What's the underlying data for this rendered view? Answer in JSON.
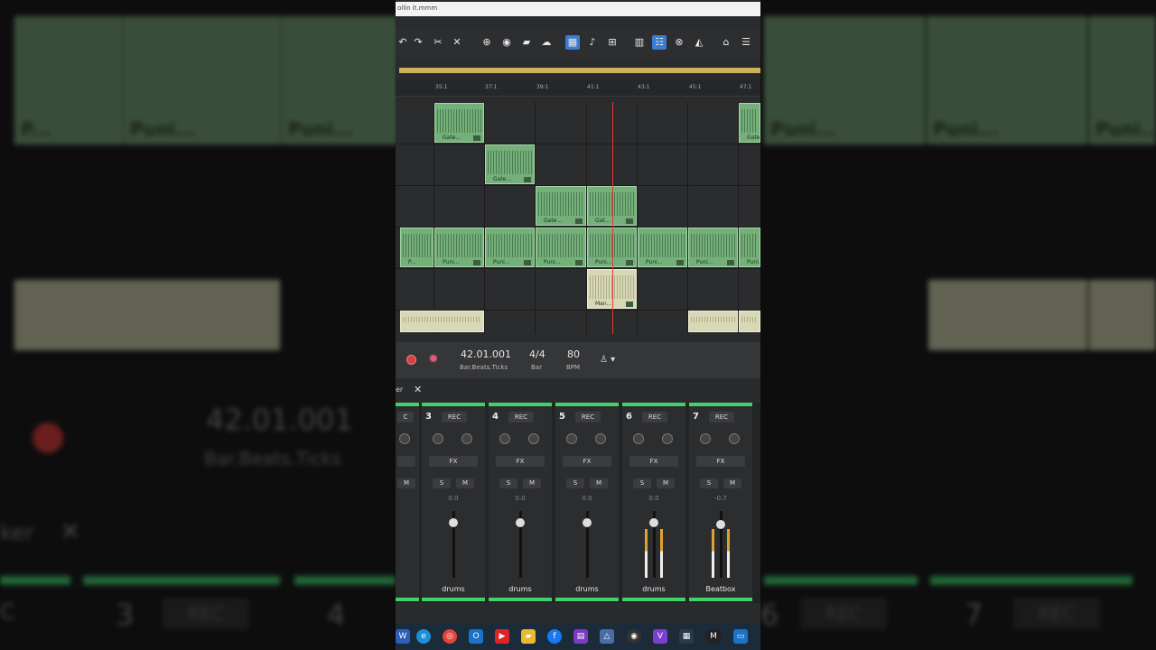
{
  "window": {
    "title": "ollin it.mmm"
  },
  "ruler": {
    "markers": [
      "35:1",
      "37:1",
      "39:1",
      "41:1",
      "43:1",
      "45:1",
      "47:1"
    ]
  },
  "clips": {
    "gate": "Gate...",
    "gat": "Gat...",
    "puni": "Puni...",
    "p": "P...",
    "man": "Man..."
  },
  "transport": {
    "position": "42.01.001",
    "position_label": "Bar.Beats.Ticks",
    "signature": "4/4",
    "signature_label": "Bar",
    "tempo": "80",
    "tempo_label": "BPM",
    "record_color": "#d84040"
  },
  "mixer": {
    "tab_label": "er",
    "partial_strip": {
      "rec": "C",
      "mute": "M",
      "name": "s"
    },
    "strips": [
      {
        "number": "3",
        "rec": "REC",
        "fx": "FX",
        "solo": "S",
        "mute": "M",
        "db": "0.0",
        "name": "drums"
      },
      {
        "number": "4",
        "rec": "REC",
        "fx": "FX",
        "solo": "S",
        "mute": "M",
        "db": "0.0",
        "name": "drums"
      },
      {
        "number": "5",
        "rec": "REC",
        "fx": "FX",
        "solo": "S",
        "mute": "M",
        "db": "0.0",
        "name": "drums"
      },
      {
        "number": "6",
        "rec": "REC",
        "fx": "FX",
        "solo": "S",
        "mute": "M",
        "db": "0.0",
        "name": "drums"
      },
      {
        "number": "7",
        "rec": "REC",
        "fx": "FX",
        "solo": "S",
        "mute": "M",
        "db": "-0.7",
        "name": "Beatbox"
      }
    ]
  },
  "background": {
    "position": "42.01.001",
    "position_label": "Bar.Beats.Ticks",
    "tab_label": "ker",
    "clip_labels": [
      "P...",
      "Puni...",
      "Puni...",
      "Puni...",
      "Puni...",
      "Puni..."
    ],
    "strip_numbers": [
      "3",
      "4",
      "7"
    ],
    "rec_labels": [
      "C",
      "REC",
      "REC",
      "REC"
    ],
    "partial_number": "6"
  },
  "accent_colors": {
    "clip": "#75b07b",
    "meter_green": "#3ed26c",
    "active_tool": "#3a7bd5"
  }
}
